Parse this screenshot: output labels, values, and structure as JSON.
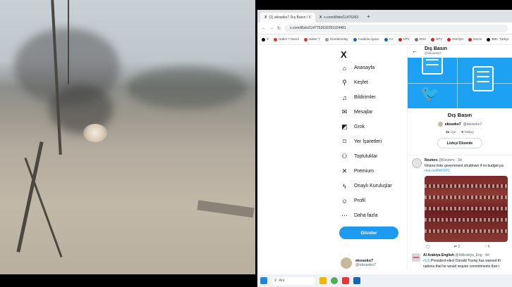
{
  "browser": {
    "tabs": [
      {
        "label": "(1) ekoseko7 Dış Basın / X",
        "active": true
      },
      {
        "label": "x.com/i/lists/11476363",
        "active": false
      }
    ],
    "new_tab": "+",
    "url": "x.com/i/lists/1147752632251924481",
    "bookmarks": [
      "X",
      "Haber 7 Nevel",
      "Haber 7",
      "Gündem/day",
      "Anadolu Ajansı",
      "AA",
      "NTV",
      "DHA",
      "NTV",
      "Hürriyet",
      "Sözcü",
      "BBC Türkçe"
    ]
  },
  "sidebar": {
    "logo": "X",
    "items": [
      {
        "label": "Anasayfa",
        "icon": "home-icon",
        "glyph": "⌂"
      },
      {
        "label": "Keşfet",
        "icon": "search-icon",
        "glyph": "⚲"
      },
      {
        "label": "Bildirimler",
        "icon": "bell-icon",
        "glyph": "♫"
      },
      {
        "label": "Mesajlar",
        "icon": "mail-icon",
        "glyph": "✉"
      },
      {
        "label": "Grok",
        "icon": "grok-icon",
        "glyph": "◩"
      },
      {
        "label": "Yer İşaretleri",
        "icon": "bookmark-icon",
        "glyph": "⌑"
      },
      {
        "label": "Topluluklar",
        "icon": "communities-icon",
        "glyph": "⚇"
      },
      {
        "label": "Premium",
        "icon": "x-premium-icon",
        "glyph": "✕"
      },
      {
        "label": "Onaylı Kuruluşlar",
        "icon": "lightning-icon",
        "glyph": "ϟ"
      },
      {
        "label": "Profil",
        "icon": "profile-icon",
        "glyph": "☺"
      },
      {
        "label": "Daha fazla",
        "icon": "more-icon",
        "glyph": "⋯"
      }
    ],
    "post_button": "Gönder",
    "account": {
      "name": "ekoseko7",
      "handle": "@ekoseko7"
    }
  },
  "list": {
    "header_title": "Dış Basın",
    "header_handle": "@ekoseko7",
    "name": "Dış Basın",
    "owner_name": "ekoseko7",
    "owner_handle": "@ekoseko7",
    "members_count": "21",
    "members_label": "Üye",
    "followers_count": "0",
    "followers_label": "Takipçi",
    "edit_button": "Listeyi Düzenle"
  },
  "tweets": [
    {
      "name": "Reuters",
      "handle": "@Reuters",
      "time": "3d",
      "text": "Ghana risks government shutdown if no budget pa",
      "link": "reut.rs/4lhKOFC",
      "replies": "",
      "retweets": "3",
      "likes": "6"
    },
    {
      "name": "Al Arabiya English",
      "handle": "@AlArabiya_Eng",
      "time": "4d",
      "text_hashtag": "#US",
      "text": " President-elect Donald Trump has warned th",
      "text2": "nations that he would require commitments that t"
    }
  ],
  "taskbar": {
    "search": "Ara"
  }
}
